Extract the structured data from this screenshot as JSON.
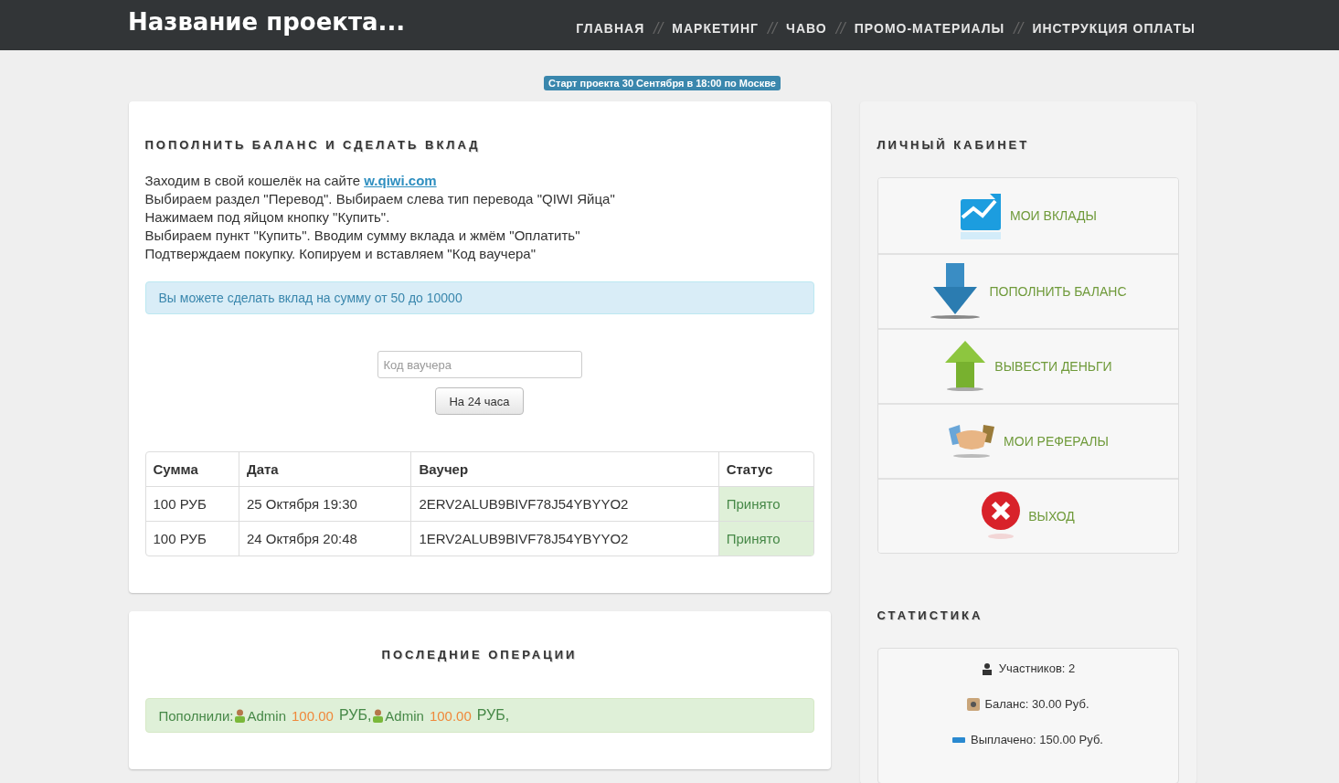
{
  "header": {
    "brand": "Название проекта...",
    "nav": [
      {
        "label": "ГЛАВНАЯ"
      },
      {
        "label": "МАРКЕТИНГ"
      },
      {
        "label": "ЧАВО"
      },
      {
        "label": "ПРОМО-МАТЕРИАЛЫ"
      },
      {
        "label": "ИНСТРУКЦИЯ ОПЛАТЫ"
      }
    ],
    "separator": "//"
  },
  "start_badge": "Старт проекта 30 Сентября в 18:00 по Москве",
  "deposit": {
    "title": "ПОПОЛНИТЬ БАЛАНС И СДЕЛАТЬ ВКЛАД",
    "intro": "Заходим в свой кошелёк на сайте",
    "link": "w.qiwi.com",
    "steps": [
      "Выбираем раздел \"Перевод\". Выбираем слева тип перевода \"QIWI Яйца\"",
      "Нажимаем под яйцом кнопку \"Купить\".",
      "Выбираем пункт \"Купить\". Вводим сумму вклада и жмём \"Оплатить\"",
      "Подтверждаем покупку. Копируем и вставляем \"Код ваучера\""
    ],
    "info": "Вы можете сделать вклад на сумму от 50 до 10000",
    "voucher_field": {
      "placeholder": "Код ваучера"
    },
    "submit": "На 24 часа",
    "table": {
      "columns": [
        "Сумма",
        "Дата",
        "Ваучер",
        "Статус"
      ],
      "rows": [
        {
          "amount": "100 РУБ",
          "date": "25 Октября 19:30",
          "voucher": "2ERV2ALUB9BIVF78J54YBYYO2",
          "status": "Принято"
        },
        {
          "amount": "100 РУБ",
          "date": "24 Октября 20:48",
          "voucher": "1ERV2ALUB9BIVF78J54YBYYO2",
          "status": "Принято"
        }
      ]
    }
  },
  "operations": {
    "title": "ПОСЛЕДНИЕ ОПЕРАЦИИ",
    "label": "Пополнили:",
    "entries": [
      {
        "name": "Admin",
        "amount": "100.00",
        "currency": "РУБ,"
      },
      {
        "name": "Admin",
        "amount": "100.00",
        "currency": "РУБ,"
      }
    ]
  },
  "cabinet": {
    "title": "ЛИЧНЫЙ КАБИНЕТ",
    "items": [
      {
        "kind": "chart",
        "label": "МОИ ВКЛАДЫ"
      },
      {
        "kind": "down",
        "label": "ПОПОЛНИТЬ БАЛАНС"
      },
      {
        "kind": "up",
        "label": "ВЫВЕСТИ ДЕНЬГИ"
      },
      {
        "kind": "handshake",
        "label": "МОИ РЕФЕРАЛЫ"
      },
      {
        "kind": "exit",
        "label": "ВЫХОД"
      }
    ]
  },
  "stats": {
    "title": "СТАТИСТИКА",
    "items": [
      {
        "kind": "users",
        "text": "Участников: 2"
      },
      {
        "kind": "safe",
        "text": "Баланс: 30.00 Руб."
      },
      {
        "kind": "bar",
        "text": "Выплачено: 150.00 Руб."
      }
    ]
  }
}
